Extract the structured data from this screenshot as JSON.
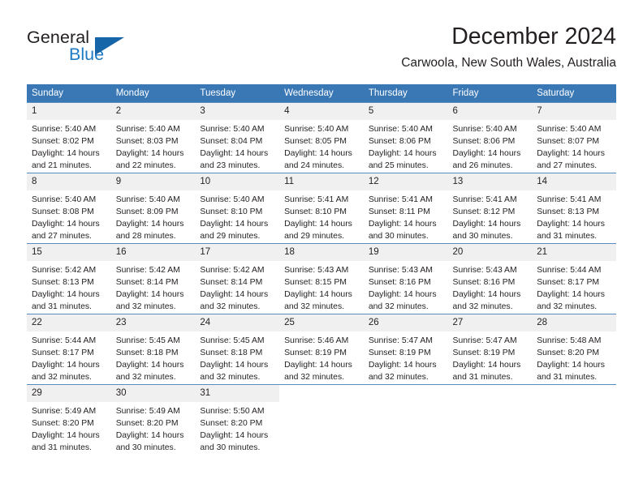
{
  "brand": {
    "name_part1": "General",
    "name_part2": "Blue",
    "accent_color": "#1f7ac4",
    "triangle_color": "#1565a8"
  },
  "header": {
    "title": "December 2024",
    "subtitle": "Carwoola, New South Wales, Australia"
  },
  "calendar": {
    "header_bg": "#3a78b5",
    "header_text_color": "#ffffff",
    "daynum_bg": "#f0f0f0",
    "weekdays": [
      "Sunday",
      "Monday",
      "Tuesday",
      "Wednesday",
      "Thursday",
      "Friday",
      "Saturday"
    ],
    "labels": {
      "sunrise": "Sunrise:",
      "sunset": "Sunset:",
      "daylight": "Daylight:"
    },
    "weeks": [
      [
        {
          "day": "1",
          "sunrise": "Sunrise: 5:40 AM",
          "sunset": "Sunset: 8:02 PM",
          "daylight_line1": "Daylight: 14 hours",
          "daylight_line2": "and 21 minutes."
        },
        {
          "day": "2",
          "sunrise": "Sunrise: 5:40 AM",
          "sunset": "Sunset: 8:03 PM",
          "daylight_line1": "Daylight: 14 hours",
          "daylight_line2": "and 22 minutes."
        },
        {
          "day": "3",
          "sunrise": "Sunrise: 5:40 AM",
          "sunset": "Sunset: 8:04 PM",
          "daylight_line1": "Daylight: 14 hours",
          "daylight_line2": "and 23 minutes."
        },
        {
          "day": "4",
          "sunrise": "Sunrise: 5:40 AM",
          "sunset": "Sunset: 8:05 PM",
          "daylight_line1": "Daylight: 14 hours",
          "daylight_line2": "and 24 minutes."
        },
        {
          "day": "5",
          "sunrise": "Sunrise: 5:40 AM",
          "sunset": "Sunset: 8:06 PM",
          "daylight_line1": "Daylight: 14 hours",
          "daylight_line2": "and 25 minutes."
        },
        {
          "day": "6",
          "sunrise": "Sunrise: 5:40 AM",
          "sunset": "Sunset: 8:06 PM",
          "daylight_line1": "Daylight: 14 hours",
          "daylight_line2": "and 26 minutes."
        },
        {
          "day": "7",
          "sunrise": "Sunrise: 5:40 AM",
          "sunset": "Sunset: 8:07 PM",
          "daylight_line1": "Daylight: 14 hours",
          "daylight_line2": "and 27 minutes."
        }
      ],
      [
        {
          "day": "8",
          "sunrise": "Sunrise: 5:40 AM",
          "sunset": "Sunset: 8:08 PM",
          "daylight_line1": "Daylight: 14 hours",
          "daylight_line2": "and 27 minutes."
        },
        {
          "day": "9",
          "sunrise": "Sunrise: 5:40 AM",
          "sunset": "Sunset: 8:09 PM",
          "daylight_line1": "Daylight: 14 hours",
          "daylight_line2": "and 28 minutes."
        },
        {
          "day": "10",
          "sunrise": "Sunrise: 5:40 AM",
          "sunset": "Sunset: 8:10 PM",
          "daylight_line1": "Daylight: 14 hours",
          "daylight_line2": "and 29 minutes."
        },
        {
          "day": "11",
          "sunrise": "Sunrise: 5:41 AM",
          "sunset": "Sunset: 8:10 PM",
          "daylight_line1": "Daylight: 14 hours",
          "daylight_line2": "and 29 minutes."
        },
        {
          "day": "12",
          "sunrise": "Sunrise: 5:41 AM",
          "sunset": "Sunset: 8:11 PM",
          "daylight_line1": "Daylight: 14 hours",
          "daylight_line2": "and 30 minutes."
        },
        {
          "day": "13",
          "sunrise": "Sunrise: 5:41 AM",
          "sunset": "Sunset: 8:12 PM",
          "daylight_line1": "Daylight: 14 hours",
          "daylight_line2": "and 30 minutes."
        },
        {
          "day": "14",
          "sunrise": "Sunrise: 5:41 AM",
          "sunset": "Sunset: 8:13 PM",
          "daylight_line1": "Daylight: 14 hours",
          "daylight_line2": "and 31 minutes."
        }
      ],
      [
        {
          "day": "15",
          "sunrise": "Sunrise: 5:42 AM",
          "sunset": "Sunset: 8:13 PM",
          "daylight_line1": "Daylight: 14 hours",
          "daylight_line2": "and 31 minutes."
        },
        {
          "day": "16",
          "sunrise": "Sunrise: 5:42 AM",
          "sunset": "Sunset: 8:14 PM",
          "daylight_line1": "Daylight: 14 hours",
          "daylight_line2": "and 32 minutes."
        },
        {
          "day": "17",
          "sunrise": "Sunrise: 5:42 AM",
          "sunset": "Sunset: 8:14 PM",
          "daylight_line1": "Daylight: 14 hours",
          "daylight_line2": "and 32 minutes."
        },
        {
          "day": "18",
          "sunrise": "Sunrise: 5:43 AM",
          "sunset": "Sunset: 8:15 PM",
          "daylight_line1": "Daylight: 14 hours",
          "daylight_line2": "and 32 minutes."
        },
        {
          "day": "19",
          "sunrise": "Sunrise: 5:43 AM",
          "sunset": "Sunset: 8:16 PM",
          "daylight_line1": "Daylight: 14 hours",
          "daylight_line2": "and 32 minutes."
        },
        {
          "day": "20",
          "sunrise": "Sunrise: 5:43 AM",
          "sunset": "Sunset: 8:16 PM",
          "daylight_line1": "Daylight: 14 hours",
          "daylight_line2": "and 32 minutes."
        },
        {
          "day": "21",
          "sunrise": "Sunrise: 5:44 AM",
          "sunset": "Sunset: 8:17 PM",
          "daylight_line1": "Daylight: 14 hours",
          "daylight_line2": "and 32 minutes."
        }
      ],
      [
        {
          "day": "22",
          "sunrise": "Sunrise: 5:44 AM",
          "sunset": "Sunset: 8:17 PM",
          "daylight_line1": "Daylight: 14 hours",
          "daylight_line2": "and 32 minutes."
        },
        {
          "day": "23",
          "sunrise": "Sunrise: 5:45 AM",
          "sunset": "Sunset: 8:18 PM",
          "daylight_line1": "Daylight: 14 hours",
          "daylight_line2": "and 32 minutes."
        },
        {
          "day": "24",
          "sunrise": "Sunrise: 5:45 AM",
          "sunset": "Sunset: 8:18 PM",
          "daylight_line1": "Daylight: 14 hours",
          "daylight_line2": "and 32 minutes."
        },
        {
          "day": "25",
          "sunrise": "Sunrise: 5:46 AM",
          "sunset": "Sunset: 8:19 PM",
          "daylight_line1": "Daylight: 14 hours",
          "daylight_line2": "and 32 minutes."
        },
        {
          "day": "26",
          "sunrise": "Sunrise: 5:47 AM",
          "sunset": "Sunset: 8:19 PM",
          "daylight_line1": "Daylight: 14 hours",
          "daylight_line2": "and 32 minutes."
        },
        {
          "day": "27",
          "sunrise": "Sunrise: 5:47 AM",
          "sunset": "Sunset: 8:19 PM",
          "daylight_line1": "Daylight: 14 hours",
          "daylight_line2": "and 31 minutes."
        },
        {
          "day": "28",
          "sunrise": "Sunrise: 5:48 AM",
          "sunset": "Sunset: 8:20 PM",
          "daylight_line1": "Daylight: 14 hours",
          "daylight_line2": "and 31 minutes."
        }
      ],
      [
        {
          "day": "29",
          "sunrise": "Sunrise: 5:49 AM",
          "sunset": "Sunset: 8:20 PM",
          "daylight_line1": "Daylight: 14 hours",
          "daylight_line2": "and 31 minutes."
        },
        {
          "day": "30",
          "sunrise": "Sunrise: 5:49 AM",
          "sunset": "Sunset: 8:20 PM",
          "daylight_line1": "Daylight: 14 hours",
          "daylight_line2": "and 30 minutes."
        },
        {
          "day": "31",
          "sunrise": "Sunrise: 5:50 AM",
          "sunset": "Sunset: 8:20 PM",
          "daylight_line1": "Daylight: 14 hours",
          "daylight_line2": "and 30 minutes."
        },
        {
          "day": "",
          "sunrise": "",
          "sunset": "",
          "daylight_line1": "",
          "daylight_line2": ""
        },
        {
          "day": "",
          "sunrise": "",
          "sunset": "",
          "daylight_line1": "",
          "daylight_line2": ""
        },
        {
          "day": "",
          "sunrise": "",
          "sunset": "",
          "daylight_line1": "",
          "daylight_line2": ""
        },
        {
          "day": "",
          "sunrise": "",
          "sunset": "",
          "daylight_line1": "",
          "daylight_line2": ""
        }
      ]
    ]
  }
}
